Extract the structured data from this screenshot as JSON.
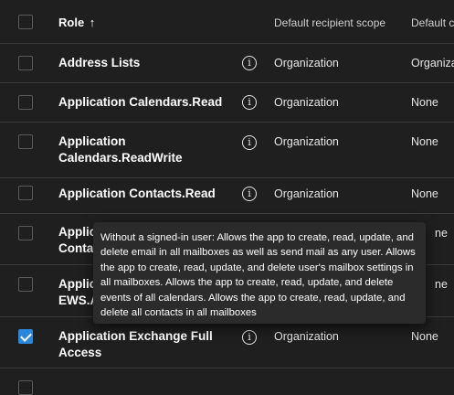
{
  "header": {
    "role_label": "Role",
    "sort_arrow": "↑",
    "col_scope": "Default recipient scope",
    "col_scope2": "Default c"
  },
  "rows": [
    {
      "label": "Address Lists",
      "scope": "Organization",
      "scope2": "Organiza",
      "checked": false
    },
    {
      "label": "Application Calendars.Read",
      "scope": "Organization",
      "scope2": "None",
      "checked": false
    },
    {
      "label": "Application Calendars.ReadWrite",
      "scope": "Organization",
      "scope2": "None",
      "checked": false
    },
    {
      "label": "Application Contacts.Read",
      "scope": "Organization",
      "scope2": "None",
      "checked": false
    },
    {
      "label": "Applic Conta",
      "scope": "",
      "scope2": "ne",
      "checked": false
    },
    {
      "label": "Applic EWS.A",
      "scope": "",
      "scope2": "ne",
      "checked": false
    },
    {
      "label": "Application Exchange Full Access",
      "scope": "Organization",
      "scope2": "None",
      "checked": true
    }
  ],
  "tooltip": {
    "text": "Without a signed-in user: Allows the app to create, read, update, and delete email in all mailboxes as well as send mail as any user. Allows the app to create, read, update, and delete user's mailbox settings in all mailboxes. Allows the app to create, read, update, and delete events of all calendars. Allows the app to create, read, update, and delete all contacts in all mailboxes"
  },
  "icons": {
    "info": "info-icon",
    "check": "checkmark-icon",
    "sort": "sort-ascending-icon"
  },
  "colors": {
    "background": "#1f1f1f",
    "accent": "#2b88d8",
    "divider": "#3a3a3a",
    "tooltip_bg": "#2b2b2b"
  }
}
